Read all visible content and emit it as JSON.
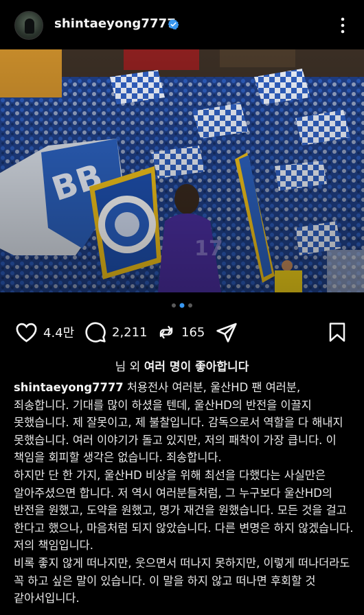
{
  "header": {
    "username": "shintaeyong7777",
    "avatar_icon": "profile-avatar",
    "verified_icon": "verified-badge-icon",
    "more_icon": "more-options-icon"
  },
  "carousel": {
    "total": 3,
    "active": 2
  },
  "actions": {
    "likes": "4.4만",
    "comments": "2,211",
    "reposts": "165",
    "like_icon": "heart-icon",
    "comment_icon": "comment-icon",
    "repost_icon": "repost-icon",
    "share_icon": "send-icon",
    "save_icon": "bookmark-icon"
  },
  "liked_by": {
    "prefix": "님 외",
    "bold": "여러 명이 좋아합니다"
  },
  "caption": {
    "username": "shintaeyong7777",
    "lines": [
      "처용전사 여러분, 울산HD 팬 여러분,",
      "죄송합니다. 기대를 많이 하셨을 텐데, 울산HD의 반전을 이끌지 못했습니다. 제 잘못이고, 제 불찰입니다. 감독으로서 역할을 다 해내지 못했습니다. 여러 이야기가 돌고 있지만, 저의 패착이 가장 큽니다. 이 책임을 회피할 생각은 없습니다. 죄송합니다.",
      "하지만 단 한 가지, 울산HD 비상을 위해 최선을 다했다는 사실만은 알아주셨으면 합니다. 저 역시 여러분들처럼, 그 누구보다 울산HD의 반전을 원했고, 도약을 원했고, 명가 재건을 원했습니다. 모든 것을 걸고 한다고 했으나, 마음처럼 되지 않았습니다. 다른 변명은 하지 않겠습니다. 저의 책임입니다.",
      "비록 좋지 않게 떠나지만, 웃으면서 떠나지 못하지만, 이렇게 떠나더라도 꼭 하고 싶은 말이 있습니다. 이 말을 하지 않고 떠나면 후회할 것 같아서입니다."
    ]
  },
  "colors": {
    "background": "#000000",
    "text": "#f5f5f5",
    "verified": "#3897f0",
    "dot_active": "#3897f0",
    "dot_inactive": "#5a5a5a"
  }
}
